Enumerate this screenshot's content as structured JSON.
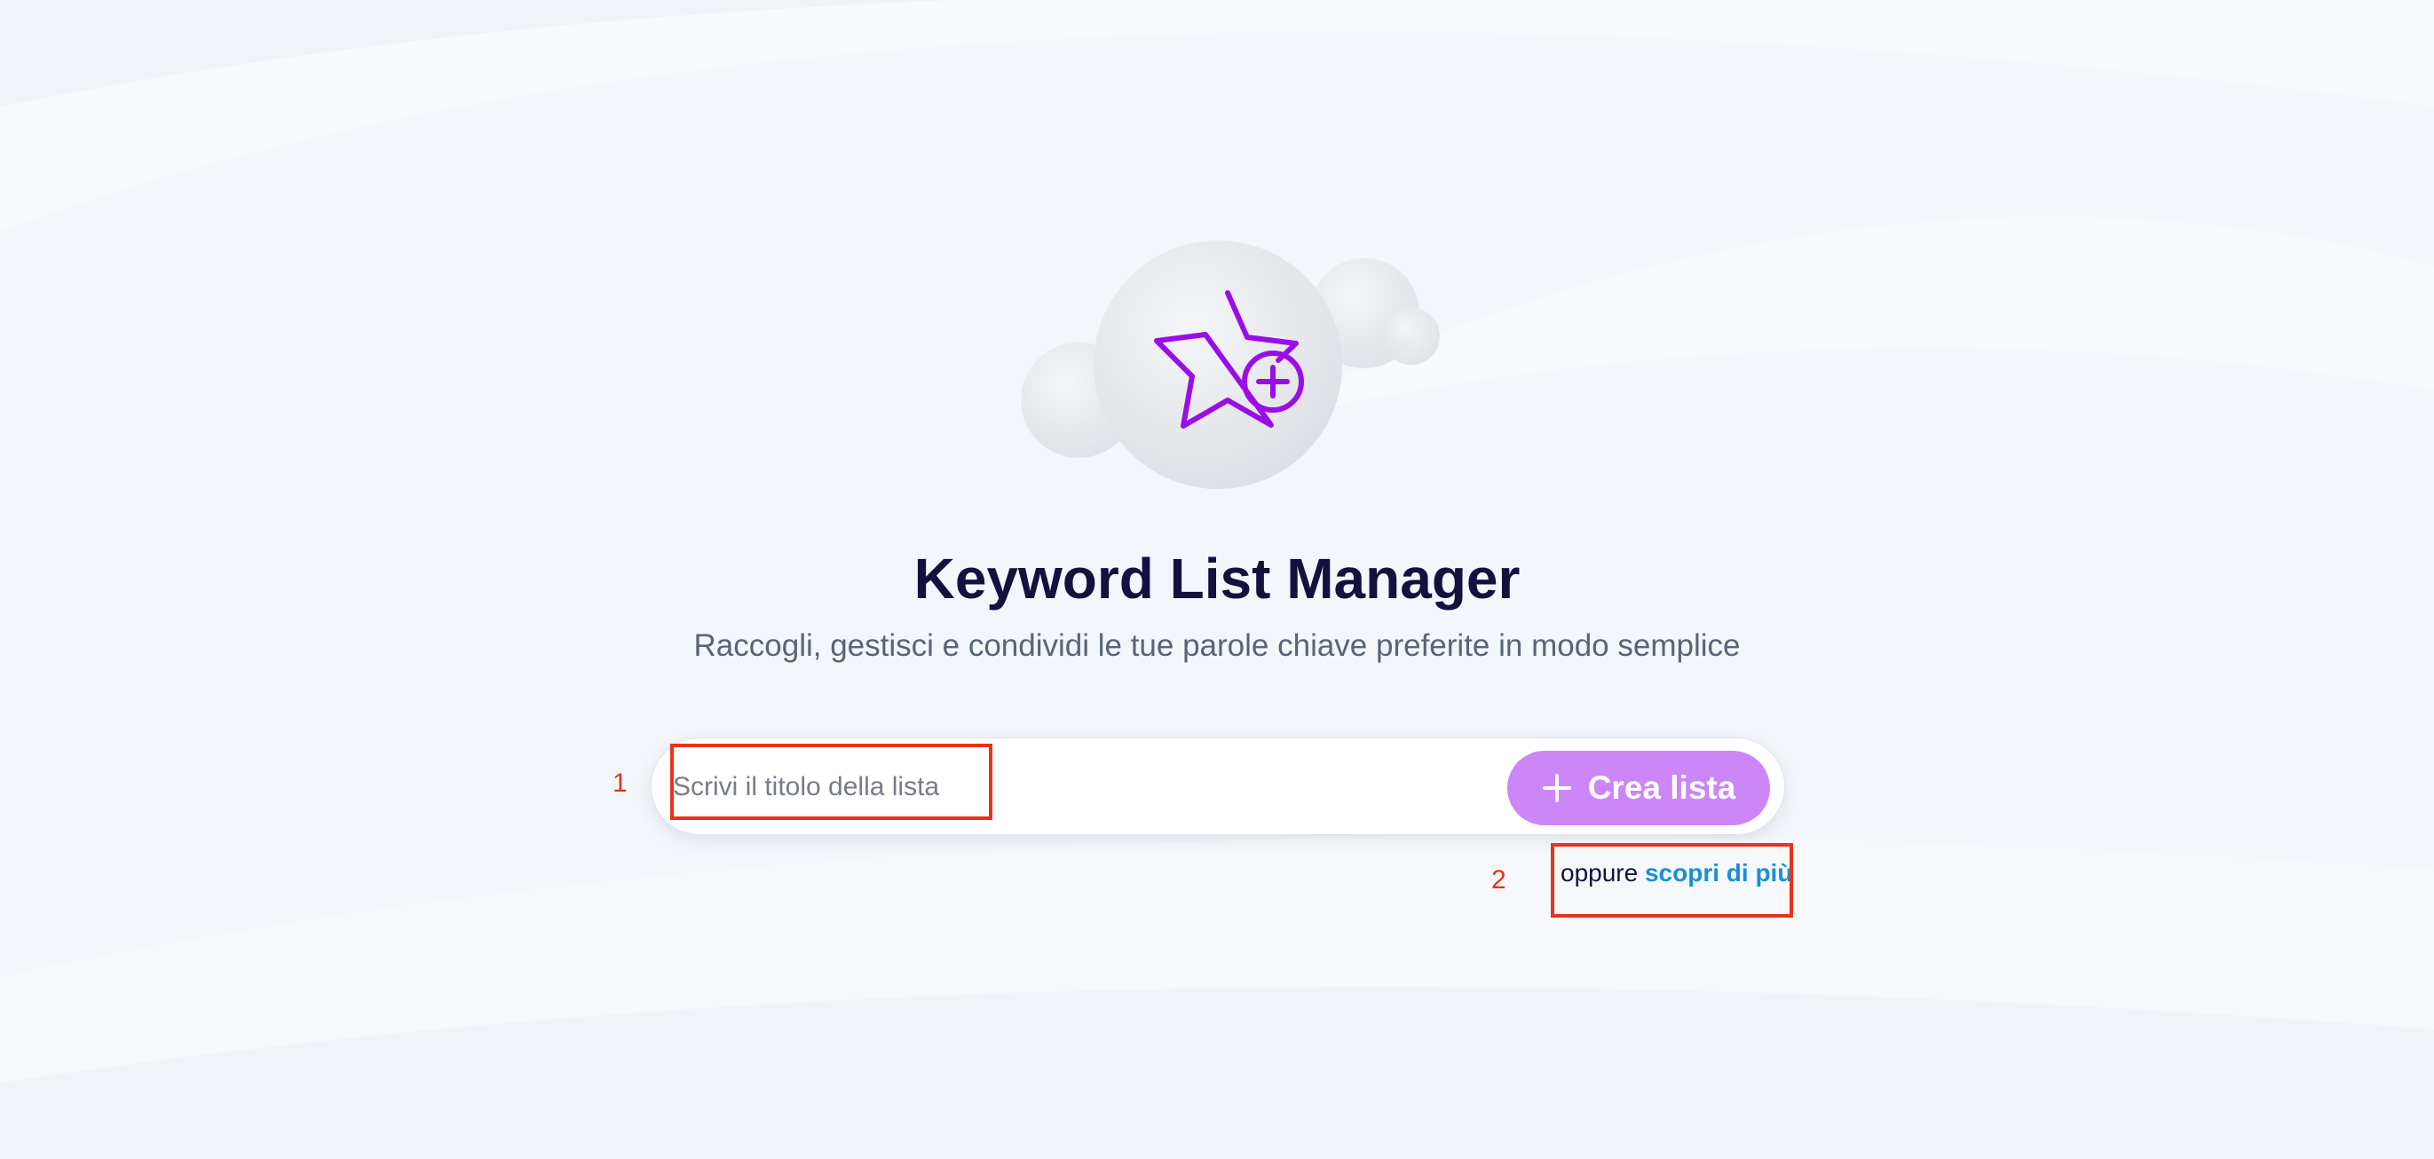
{
  "app": {
    "title": "Keyword List Manager",
    "subtitle": "Raccogli, gestisci e condividi le tue parole chiave preferite in modo semplice"
  },
  "form": {
    "input_placeholder": "Scrivi il titolo della lista",
    "input_value": "",
    "create_button_label": "Crea lista",
    "create_button_icon": "plus-icon"
  },
  "alt_link": {
    "prefix": "oppure",
    "link_label": "scopri di più"
  },
  "annotations": [
    {
      "number": "1"
    },
    {
      "number": "2"
    }
  ],
  "colors": {
    "background": "#f3f6fa",
    "title": "#14113f",
    "subtitle": "#5a6478",
    "accent_purple": "#cc86f7",
    "icon_purple": "#9a0ee6",
    "link_blue": "#1a8fd6",
    "annotation_red": "#e8331c"
  },
  "hero_icon": "star-plus-icon"
}
